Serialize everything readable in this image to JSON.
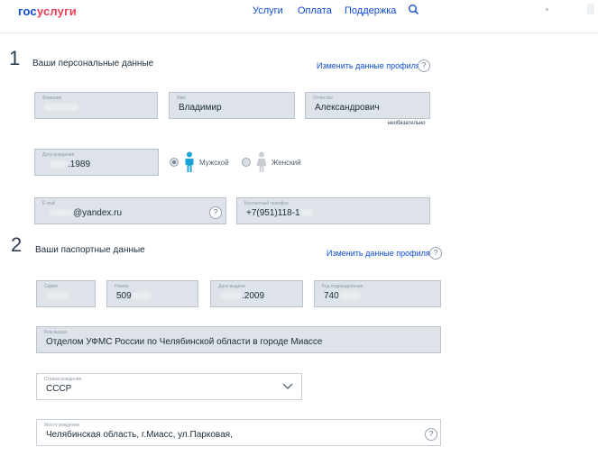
{
  "header": {
    "logo_part1": "гос",
    "logo_part2": "услуги",
    "nav": [
      "Услуги",
      "Оплата",
      "Поддержка"
    ]
  },
  "section1": {
    "number": "1",
    "title": "Ваши персональные данные",
    "edit_link": "Изменить данные профиля",
    "help": "?",
    "surname": {
      "label": "Фамилия",
      "value": ""
    },
    "name": {
      "label": "Имя",
      "value": "Владимир"
    },
    "patronymic": {
      "label": "Отчество",
      "value": "Александрович",
      "hint": "необязательно"
    },
    "birthdate": {
      "label": "Дата рождения",
      "value": ".1989"
    },
    "gender": {
      "male": "Мужской",
      "female": "Женский",
      "selected": "male"
    },
    "email": {
      "label": "E-mail",
      "value": "@yandex.ru",
      "help": "?"
    },
    "phone": {
      "label": "Контактный телефон",
      "value": "+7(951)118-1"
    }
  },
  "section2": {
    "number": "2",
    "title": "Ваши паспортные данные",
    "edit_link": "Изменить данные профиля",
    "help": "?",
    "series": {
      "label": "Серия",
      "value": ""
    },
    "number_field": {
      "label": "Номер",
      "value": "509"
    },
    "issue_date": {
      "label": "Дата выдачи",
      "value": ".2009"
    },
    "dept_code": {
      "label": "Код подразделения",
      "value": "740"
    },
    "issued_by": {
      "label": "Кем выдан",
      "value": "Отделом УФМС России по Челябинской области в городе Миассе"
    },
    "birth_country": {
      "label": "Страна рождения",
      "value": "СССР"
    },
    "birth_place": {
      "label": "Место рождения",
      "value": "Челябинская область, г.Миасс, ул.Парковая,",
      "help": "?"
    }
  },
  "colors": {
    "brand_blue": "#0d4cd3",
    "brand_red": "#ee3f58",
    "field_bg": "#dde3e8",
    "male_icon": "#1aa3d9"
  }
}
